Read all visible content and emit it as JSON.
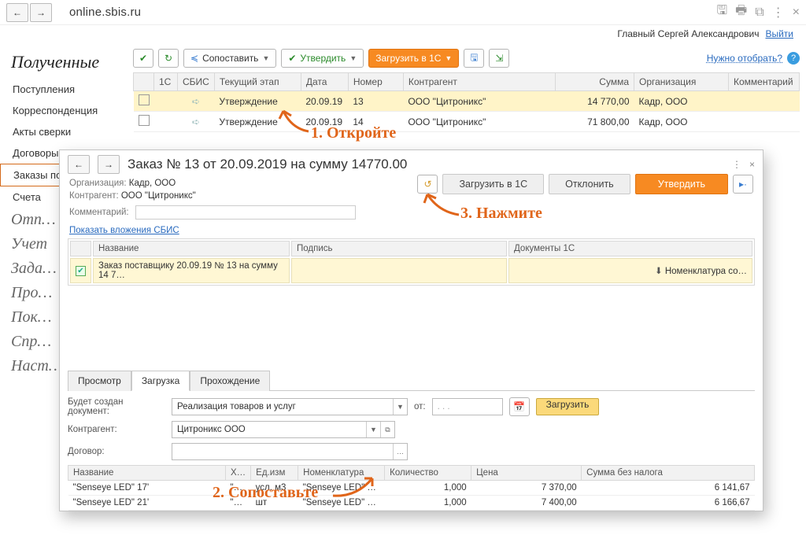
{
  "topbar": {
    "url": "online.sbis.ru"
  },
  "user": {
    "name": "Главный Сергей Александрович",
    "logout": "Выйти"
  },
  "sidebar": {
    "title": "Полученные",
    "items": [
      "Поступления",
      "Корреспонденция",
      "Акты сверки",
      "Договоры",
      "Заказы покупателей",
      "Счета"
    ],
    "faded": [
      "Отп…",
      "Учет",
      "Зада…",
      "Про…",
      "Пок…",
      "Спр…",
      "Наст…"
    ]
  },
  "toolbar": {
    "match": "Сопоставить",
    "approve": "Утвердить",
    "load1c": "Загрузить в 1С",
    "filter": "Нужно отобрать?"
  },
  "grid": {
    "headers": {
      "c1": "1С",
      "c2": "СБИС",
      "c3": "Текущий этап",
      "c4": "Дата",
      "c5": "Номер",
      "c6": "Контрагент",
      "c7": "Сумма",
      "c8": "Организация",
      "c9": "Комментарий"
    },
    "rows": [
      {
        "stage": "Утверждение",
        "date": "20.09.19",
        "num": "13",
        "contr": "ООО \"Цитроникс\"",
        "sum": "14 770,00",
        "org": "Кадр, ООО"
      },
      {
        "stage": "Утверждение",
        "date": "20.09.19",
        "num": "14",
        "contr": "ООО \"Цитроникс\"",
        "sum": "71 800,00",
        "org": "Кадр, ООО"
      }
    ]
  },
  "dialog": {
    "title": "Заказ № 13 от 20.09.2019 на сумму 14770.00",
    "meta": {
      "org_l": "Организация:",
      "org_v": "Кадр, ООО",
      "contr_l": "Контрагент:",
      "contr_v": "ООО \"Цитроникс\"",
      "comment_l": "Комментарий:"
    },
    "actions": {
      "load1c": "Загрузить в 1С",
      "reject": "Отклонить",
      "approve": "Утвердить"
    },
    "show_att": "Показать вложения СБИС",
    "inner": {
      "h1": "Название",
      "h2": "Подпись",
      "h3": "Документы 1С",
      "row": "Заказ поставщику 20.09.19 № 13 на сумму 14 7…",
      "nomen": "Номенклатура со…"
    },
    "tabs": [
      "Просмотр",
      "Загрузка",
      "Прохождение"
    ],
    "form": {
      "doc_l": "Будет создан документ:",
      "doc_v": "Реализация товаров и услуг",
      "from_l": "от:",
      "date_ph": ". .    .",
      "contr_l": "Контрагент:",
      "contr_v": "Цитроникс ООО",
      "agr_l": "Договор:",
      "load": "Загрузить"
    },
    "items": {
      "h": {
        "name": "Название",
        "x": "Х…",
        "unit": "Ед.изм",
        "nomen": "Номенклатура",
        "qty": "Количество",
        "price": "Цена",
        "sum": "Сумма без налога"
      },
      "rows": [
        {
          "name": "\"Senseye LED\" 17'",
          "x": "\"…",
          "unit": "усл. м3",
          "nomen": "\"Senseye LED\" …",
          "qty": "1,000",
          "price": "7 370,00",
          "sum": "6 141,67"
        },
        {
          "name": "\"Senseye LED\" 21'",
          "x": "\"…",
          "unit": "шт",
          "nomen": "\"Senseye LED\" …",
          "qty": "1,000",
          "price": "7 400,00",
          "sum": "6 166,67"
        }
      ]
    }
  },
  "anno": {
    "a1": "1. Откройте",
    "a2": "2. Сопоставьте",
    "a3": "3. Нажмите"
  }
}
